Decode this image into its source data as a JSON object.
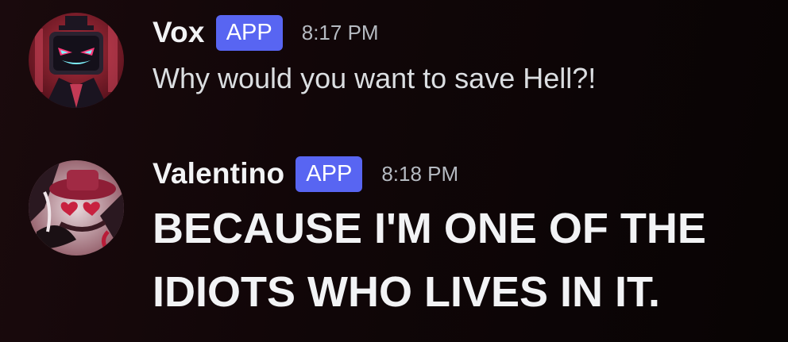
{
  "messages": [
    {
      "author": "Vox",
      "badge": "APP",
      "time": "8:17 PM",
      "text": "Why would you want to save Hell?!",
      "avatar_icon": "vox-avatar-icon"
    },
    {
      "author": "Valentino",
      "badge": "APP",
      "time": "8:18 PM",
      "text": "BECAUSE I'M ONE OF THE IDIOTS WHO LIVES IN IT.",
      "avatar_icon": "valentino-avatar-icon"
    }
  ],
  "colors": {
    "badge": "#5865f2",
    "username": "#f2f3f5",
    "timestamp": "#b5bac1",
    "message_text": "#dbdee1",
    "background": "#110608"
  }
}
